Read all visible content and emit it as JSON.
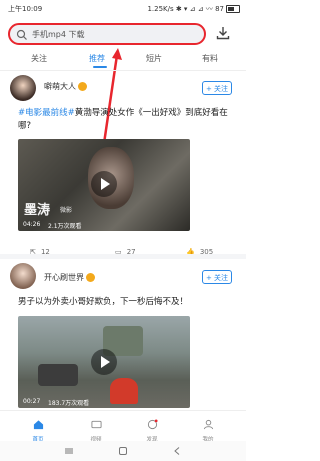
{
  "status": {
    "time": "上午10:09",
    "right": "1.25K/s ✱ ▾ ⊿ ⊿ 〰 87"
  },
  "search": {
    "placeholder": "手机mp4 下载"
  },
  "tabs": [
    {
      "label": "关注"
    },
    {
      "label": "推荐"
    },
    {
      "label": "短片"
    },
    {
      "label": "有料"
    }
  ],
  "posts": [
    {
      "author": "噼萌大人",
      "follow": "+ 关注",
      "title_hashtags": "#电影最前线#",
      "title_text": "黄渤导演处女作《一出好戏》到底好看在哪?",
      "video_caption": "墨涛",
      "video_sub": "微影",
      "duration": "04:26",
      "plays": "2.1万次观看",
      "comments": "12",
      "likes_shares": "27",
      "likes": "305"
    },
    {
      "author": "开心刷世界",
      "follow": "+ 关注",
      "title_text": "男子以为外卖小哥好欺负，下一秒后悔不及！",
      "duration": "00:27",
      "plays": "183.7万次观看"
    }
  ],
  "nav": [
    {
      "label": "首页"
    },
    {
      "label": "视频"
    },
    {
      "label": "发现"
    },
    {
      "label": "我的"
    }
  ],
  "colors": {
    "accent": "#2b88e6",
    "highlight": "#e8262e"
  }
}
